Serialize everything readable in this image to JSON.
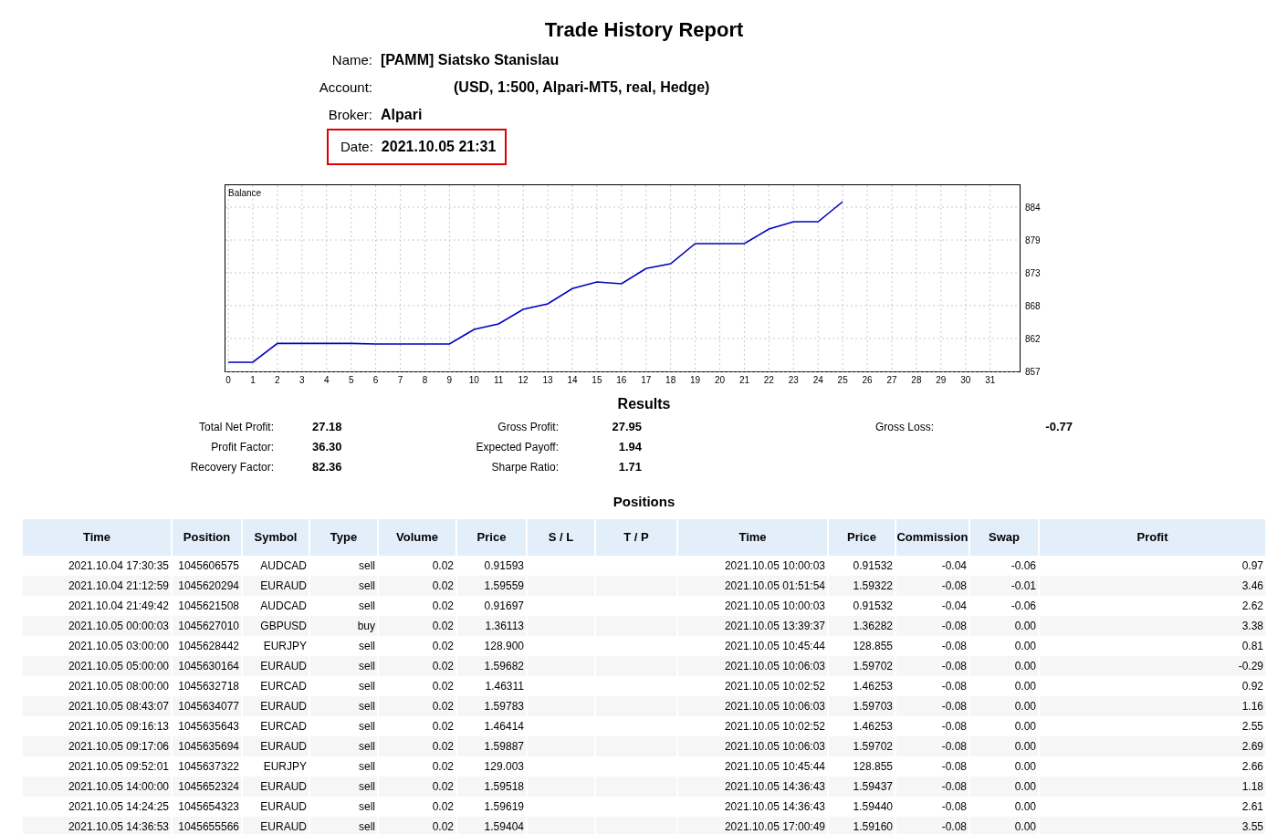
{
  "title": "Trade History Report",
  "header": [
    {
      "label": "Name:",
      "value": "[PAMM] Siatsko Stanislau",
      "highlighted": false
    },
    {
      "label": "Account:",
      "value": "(USD, 1:500, Alpari-MT5, real, Hedge)",
      "highlighted": false
    },
    {
      "label": "Broker:",
      "value": "Alpari",
      "highlighted": false
    },
    {
      "label": "Date:",
      "value": "2021.10.05 21:31",
      "highlighted": true
    }
  ],
  "chart_data": {
    "type": "line",
    "grid": true,
    "x": [
      0,
      1,
      2,
      3,
      4,
      5,
      6,
      7,
      8,
      9,
      10,
      11,
      12,
      13,
      14,
      15,
      16,
      17,
      18,
      19,
      20,
      21,
      22,
      23,
      24,
      25
    ],
    "series": [
      {
        "name": "Balance",
        "color": "#0000c0",
        "values": [
          858.5,
          858.5,
          861.6,
          861.6,
          861.6,
          861.6,
          861.5,
          861.5,
          861.5,
          861.5,
          863.9,
          864.8,
          867.2,
          868.1,
          870.6,
          871.7,
          871.4,
          873.9,
          874.7,
          878.0,
          878.0,
          878.0,
          880.4,
          881.6,
          881.6,
          884.9
        ]
      }
    ],
    "xlim": [
      -0.15,
      32.2
    ],
    "ylim": [
      857,
      887.75
    ],
    "xticks": [
      0,
      1,
      2,
      3,
      4,
      5,
      6,
      7,
      8,
      9,
      10,
      11,
      12,
      13,
      14,
      15,
      16,
      17,
      18,
      19,
      20,
      21,
      22,
      23,
      24,
      25,
      26,
      27,
      28,
      29,
      30,
      31
    ],
    "yticks": [
      {
        "value": 857.0,
        "label": "857"
      },
      {
        "value": 862.4,
        "label": "862"
      },
      {
        "value": 867.8,
        "label": "868"
      },
      {
        "value": 873.2,
        "label": "873"
      },
      {
        "value": 878.6,
        "label": "879"
      },
      {
        "value": 884.0,
        "label": "884"
      }
    ]
  },
  "results": {
    "title": "Results",
    "rows": [
      [
        {
          "label": "Total Net Profit:",
          "value": "27.18"
        },
        {
          "label": "Gross Profit:",
          "value": "27.95"
        },
        {
          "label": "Gross Loss:",
          "value": "-0.77"
        }
      ],
      [
        {
          "label": "Profit Factor:",
          "value": "36.30"
        },
        {
          "label": "Expected Payoff:",
          "value": "1.94"
        }
      ],
      [
        {
          "label": "Recovery Factor:",
          "value": "82.36"
        },
        {
          "label": "Sharpe Ratio:",
          "value": "1.71"
        }
      ]
    ]
  },
  "positions": {
    "title": "Positions",
    "columns": [
      "Time",
      "Position",
      "Symbol",
      "Type",
      "Volume",
      "Price",
      "S / L",
      "T / P",
      "Time",
      "Price",
      "Commission",
      "Swap",
      "Profit"
    ],
    "rows": [
      [
        "2021.10.04 17:30:35",
        "1045606575",
        "AUDCAD",
        "sell",
        "0.02",
        "0.91593",
        "",
        "",
        "2021.10.05 10:00:03",
        "0.91532",
        "-0.04",
        "-0.06",
        "0.97"
      ],
      [
        "2021.10.04 21:12:59",
        "1045620294",
        "EURAUD",
        "sell",
        "0.02",
        "1.59559",
        "",
        "",
        "2021.10.05 01:51:54",
        "1.59322",
        "-0.08",
        "-0.01",
        "3.46"
      ],
      [
        "2021.10.04 21:49:42",
        "1045621508",
        "AUDCAD",
        "sell",
        "0.02",
        "0.91697",
        "",
        "",
        "2021.10.05 10:00:03",
        "0.91532",
        "-0.04",
        "-0.06",
        "2.62"
      ],
      [
        "2021.10.05 00:00:03",
        "1045627010",
        "GBPUSD",
        "buy",
        "0.02",
        "1.36113",
        "",
        "",
        "2021.10.05 13:39:37",
        "1.36282",
        "-0.08",
        "0.00",
        "3.38"
      ],
      [
        "2021.10.05 03:00:00",
        "1045628442",
        "EURJPY",
        "sell",
        "0.02",
        "128.900",
        "",
        "",
        "2021.10.05 10:45:44",
        "128.855",
        "-0.08",
        "0.00",
        "0.81"
      ],
      [
        "2021.10.05 05:00:00",
        "1045630164",
        "EURAUD",
        "sell",
        "0.02",
        "1.59682",
        "",
        "",
        "2021.10.05 10:06:03",
        "1.59702",
        "-0.08",
        "0.00",
        "-0.29"
      ],
      [
        "2021.10.05 08:00:00",
        "1045632718",
        "EURCAD",
        "sell",
        "0.02",
        "1.46311",
        "",
        "",
        "2021.10.05 10:02:52",
        "1.46253",
        "-0.08",
        "0.00",
        "0.92"
      ],
      [
        "2021.10.05 08:43:07",
        "1045634077",
        "EURAUD",
        "sell",
        "0.02",
        "1.59783",
        "",
        "",
        "2021.10.05 10:06:03",
        "1.59703",
        "-0.08",
        "0.00",
        "1.16"
      ],
      [
        "2021.10.05 09:16:13",
        "1045635643",
        "EURCAD",
        "sell",
        "0.02",
        "1.46414",
        "",
        "",
        "2021.10.05 10:02:52",
        "1.46253",
        "-0.08",
        "0.00",
        "2.55"
      ],
      [
        "2021.10.05 09:17:06",
        "1045635694",
        "EURAUD",
        "sell",
        "0.02",
        "1.59887",
        "",
        "",
        "2021.10.05 10:06:03",
        "1.59702",
        "-0.08",
        "0.00",
        "2.69"
      ],
      [
        "2021.10.05 09:52:01",
        "1045637322",
        "EURJPY",
        "sell",
        "0.02",
        "129.003",
        "",
        "",
        "2021.10.05 10:45:44",
        "128.855",
        "-0.08",
        "0.00",
        "2.66"
      ],
      [
        "2021.10.05 14:00:00",
        "1045652324",
        "EURAUD",
        "sell",
        "0.02",
        "1.59518",
        "",
        "",
        "2021.10.05 14:36:43",
        "1.59437",
        "-0.08",
        "0.00",
        "1.18"
      ],
      [
        "2021.10.05 14:24:25",
        "1045654323",
        "EURAUD",
        "sell",
        "0.02",
        "1.59619",
        "",
        "",
        "2021.10.05 14:36:43",
        "1.59440",
        "-0.08",
        "0.00",
        "2.61"
      ],
      [
        "2021.10.05 14:36:53",
        "1045655566",
        "EURAUD",
        "sell",
        "0.02",
        "1.59404",
        "",
        "",
        "2021.10.05 17:00:49",
        "1.59160",
        "-0.08",
        "0.00",
        "3.55"
      ]
    ]
  }
}
